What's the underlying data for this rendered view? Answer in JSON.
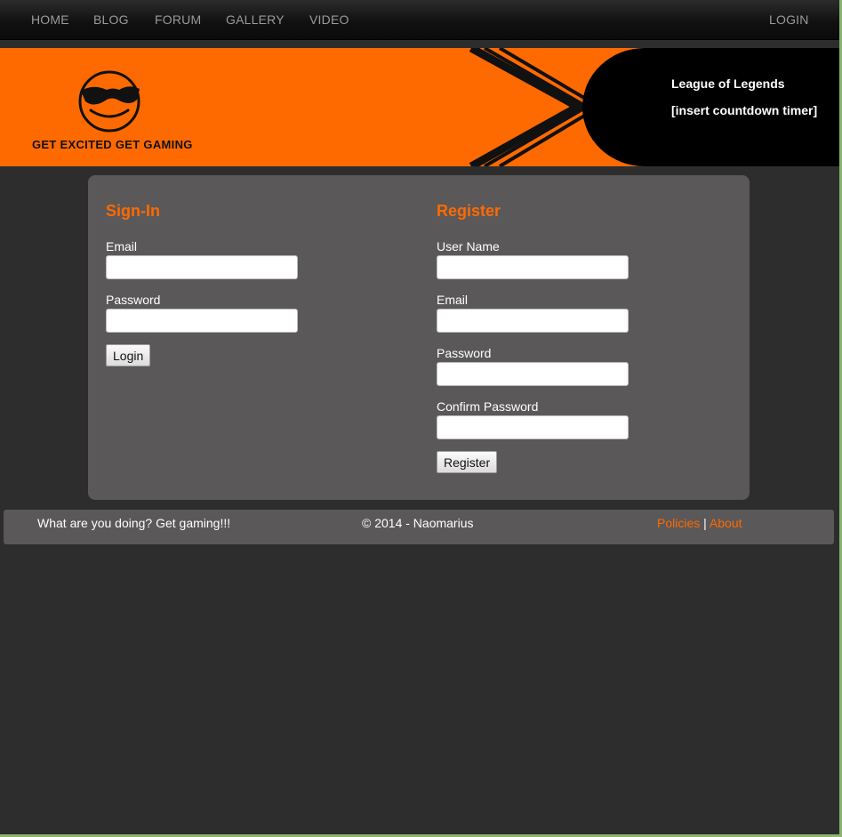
{
  "nav": {
    "home": "HOME",
    "blog": "BLOG",
    "forum": "FORUM",
    "gallery": "GALLERY",
    "video": "VIDEO",
    "login": "LOGIN"
  },
  "banner": {
    "logo_icon": "sunglasses-smiley-icon",
    "tagline": "GET EXCITED GET GAMING",
    "event_title": "League of Legends",
    "event_timer": "[insert countdown timer]"
  },
  "signin": {
    "title": "Sign-In",
    "email_label": "Email",
    "email_value": "",
    "password_label": "Password",
    "password_value": "",
    "button_label": "Login"
  },
  "register": {
    "title": "Register",
    "username_label": "User Name",
    "username_value": "",
    "email_label": "Email",
    "email_value": "",
    "password_label": "Password",
    "password_value": "",
    "confirm_label": "Confirm Password",
    "confirm_value": "",
    "button_label": "Register"
  },
  "footer": {
    "slogan": "What are you doing? Get gaming!!!",
    "copyright": "© 2014 - Naomarius",
    "policies": "Policies",
    "separator": "|",
    "about": "About"
  },
  "colors": {
    "accent": "#ff6a00",
    "background": "#2d2d2d",
    "panel": "#5a5859",
    "navbar": "#111111"
  }
}
